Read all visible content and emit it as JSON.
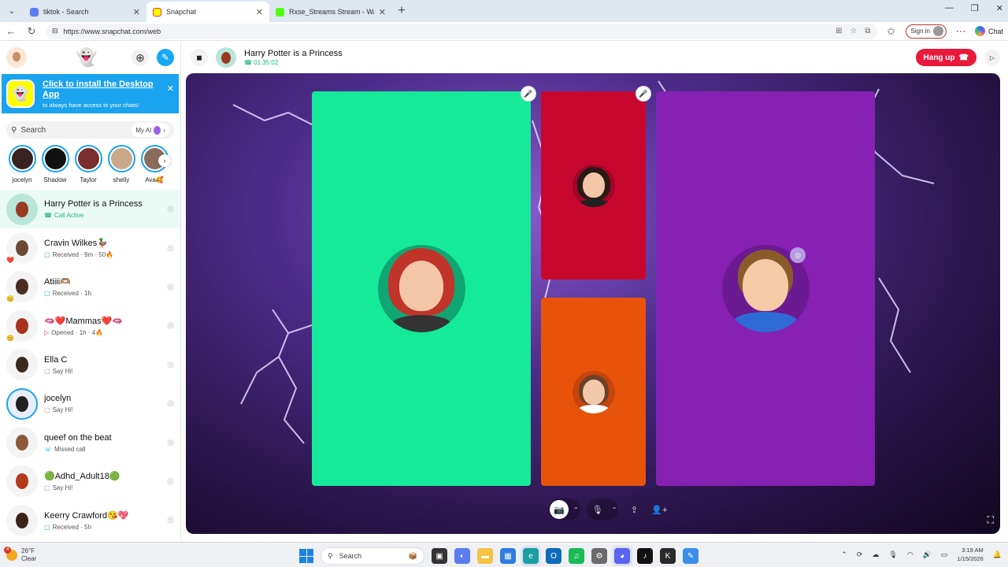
{
  "browser": {
    "tabs": [
      {
        "title": "tiktok - Search",
        "favicon_color": "#5b7cf7",
        "active": false
      },
      {
        "title": "Snapchat",
        "favicon_color": "#fffc00",
        "active": true
      },
      {
        "title": "Rxse_Streams Stream - Watch Live",
        "favicon_color": "#53fc18",
        "active": false
      }
    ],
    "url": "https://www.snapchat.com/web",
    "signin_label": "Sign in",
    "chat_label": "Chat"
  },
  "sidebar": {
    "install_banner": {
      "title": "Click to install the Desktop App",
      "subtitle": "to always have access to your chats!"
    },
    "search_placeholder": "Search",
    "my_ai_label": "My AI",
    "stories": [
      {
        "name": "jocelyn",
        "color": "#3a2222"
      },
      {
        "name": "Shadow",
        "color": "#111111"
      },
      {
        "name": "Taylor",
        "color": "#7a2d2d"
      },
      {
        "name": "shelly",
        "color": "#c9a98a"
      },
      {
        "name": "Ava🥰",
        "color": "#8a6c5a"
      }
    ],
    "chats": [
      {
        "name": "Harry Potter is a Princess",
        "status": "Call Active",
        "status_icon": "☎",
        "bg": "#b9e6d8",
        "face": "#9a3a22",
        "emoji": "",
        "active": true
      },
      {
        "name": "Cravin Wilkes🦆",
        "status": "Received · 9m · 50🔥",
        "status_icon": "▢",
        "bg": "#f4f4f4",
        "face": "#6b4a35",
        "emoji": "❤️",
        "active": false
      },
      {
        "name": "Atiiii🫶🏽",
        "status": "Received · 1h",
        "status_icon": "▢",
        "bg": "#f4f4f4",
        "face": "#4a2e20",
        "emoji": "😊",
        "active": false
      },
      {
        "name": "🫦❤️Mammas❤️🫦",
        "status": "Opened · 1h · 4🔥",
        "status_icon": "▷",
        "bg": "#f4f4f4",
        "face": "#a8321e",
        "emoji": "😊",
        "active": false
      },
      {
        "name": "Ella C",
        "status": "Say Hi!",
        "status_icon": "▢",
        "bg": "#f4f4f4",
        "face": "#3b2a1f",
        "emoji": "",
        "active": false
      },
      {
        "name": "jocelyn",
        "status": "Say Hi!",
        "status_icon": "▢",
        "bg": "#e8eef6",
        "face": "#222222",
        "emoji": "",
        "active": false
      },
      {
        "name": "queef on the beat",
        "status": "Missed call",
        "status_icon": "☏",
        "bg": "#f4f4f4",
        "face": "#8a5a3a",
        "emoji": "",
        "active": false
      },
      {
        "name": "🟢Adhd_Adult18🟢",
        "status": "Say Hi!",
        "status_icon": "▢",
        "bg": "#f4f4f4",
        "face": "#b33a1c",
        "emoji": "",
        "active": false
      },
      {
        "name": "Keerry Crawford😘💖",
        "status": "Received · 5h",
        "status_icon": "▢",
        "bg": "#f4f4f4",
        "face": "#3b2418",
        "emoji": "",
        "active": false
      }
    ]
  },
  "call": {
    "title": "Harry Potter is a Princess",
    "timer": "01:35:02",
    "hangup_label": "Hang up",
    "tiles": [
      {
        "color": "#14ea99",
        "hair": "#c0342a",
        "skin": "#f3c6a8",
        "body": "#333333",
        "muted": true
      },
      {
        "color": "#c8072f",
        "hair": "#2a1a14",
        "skin": "#f3c6a8",
        "body": "#222222",
        "muted": true
      },
      {
        "color": "#e8530c",
        "hair": "#6b4228",
        "skin": "#f1c9a9",
        "body": "#ffffff",
        "muted": false
      },
      {
        "color": "#8621b4",
        "hair": "#8a5a2b",
        "skin": "#f5cba8",
        "body": "#2f6bd4",
        "muted": false
      }
    ]
  },
  "taskbar": {
    "weather_temp": "26°F",
    "weather_desc": "Clear",
    "search_label": "Search",
    "time": "3:19 AM",
    "date": "1/15/2026"
  }
}
